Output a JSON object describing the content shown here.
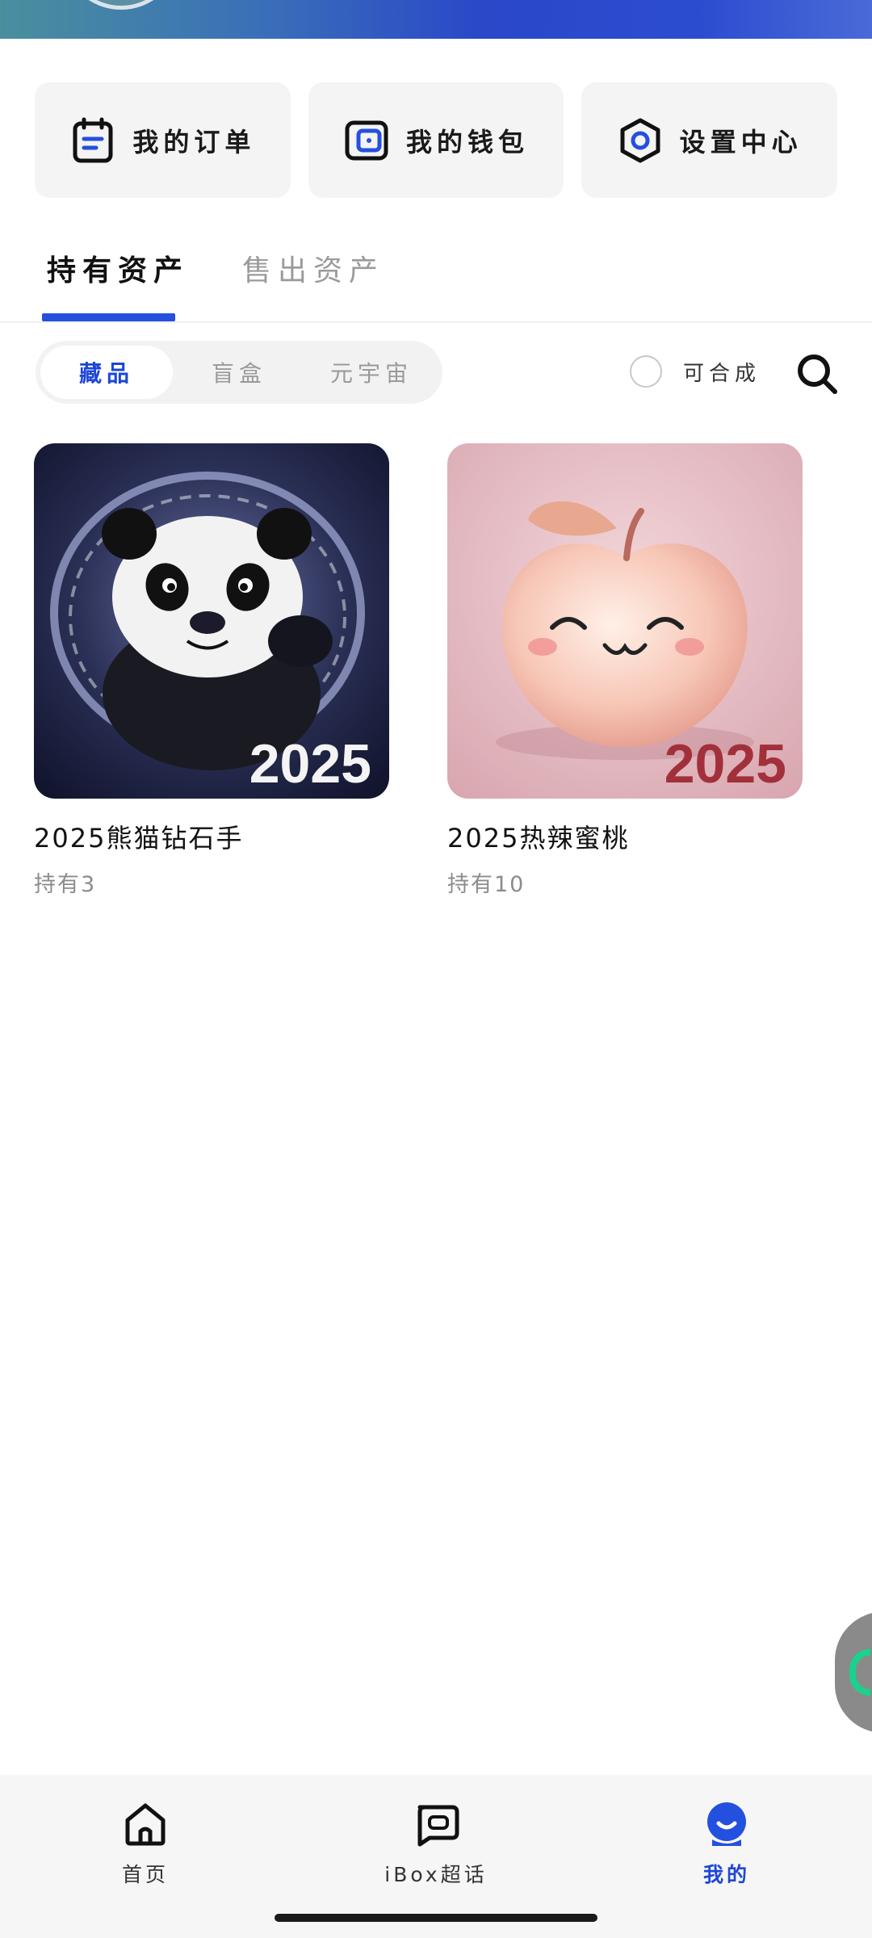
{
  "quick_actions": [
    {
      "label": "我的订单",
      "icon": "order-icon"
    },
    {
      "label": "我的钱包",
      "icon": "wallet-icon"
    },
    {
      "label": "设置中心",
      "icon": "settings-icon"
    }
  ],
  "main_tabs": [
    {
      "label": "持有资产",
      "active": true
    },
    {
      "label": "售出资产",
      "active": false
    }
  ],
  "filter_segments": [
    {
      "label": "藏品",
      "active": true
    },
    {
      "label": "盲盒",
      "active": false
    },
    {
      "label": "元宇宙",
      "active": false
    }
  ],
  "merge_toggle": {
    "label": "可合成",
    "checked": false
  },
  "collection": [
    {
      "name": "2025熊猫钻石手",
      "holding": "持有3",
      "badge": "2025"
    },
    {
      "name": "2025热辣蜜桃",
      "holding": "持有10",
      "badge": "2025"
    }
  ],
  "bottom_nav": [
    {
      "label": "首页",
      "icon": "home-icon",
      "active": false
    },
    {
      "label": "iBox超话",
      "icon": "chat-icon",
      "active": false
    },
    {
      "label": "我的",
      "icon": "profile-icon",
      "active": true
    }
  ],
  "colors": {
    "accent": "#2450E0",
    "card_bg": "#F4F4F4",
    "nav_bg": "#F6F6F6",
    "muted_text": "#9A9A9A"
  }
}
